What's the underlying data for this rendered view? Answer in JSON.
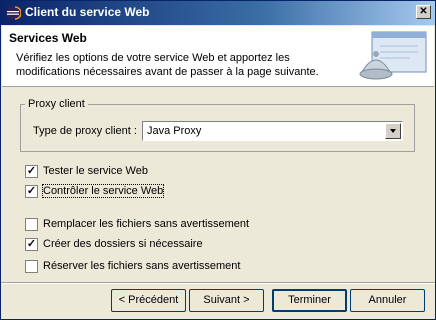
{
  "window": {
    "title": "Client du service Web",
    "close_label": "✕"
  },
  "header": {
    "title": "Services Web",
    "description": "Vérifiez les options de votre service Web et apportez les modifications nécessaires avant de passer à la page suivante."
  },
  "proxy_group": {
    "title": "Proxy client",
    "type_label": "Type de proxy client :",
    "selected": "Java Proxy"
  },
  "checkboxes": [
    {
      "label": "Tester le service Web",
      "checked": true,
      "mark": "✓"
    },
    {
      "label": "Contrôler le service Web",
      "checked": true,
      "mark": "✓"
    },
    {
      "label": "Remplacer les fichiers sans avertissement",
      "checked": false,
      "mark": ""
    },
    {
      "label": "Créer des dossiers si nécessaire",
      "checked": true,
      "mark": "✓"
    },
    {
      "label": "Réserver les fichiers sans avertissement",
      "checked": false,
      "mark": ""
    }
  ],
  "buttons": {
    "back": "< Précédent",
    "next": "Suivant >",
    "finish": "Terminer",
    "cancel": "Annuler"
  }
}
